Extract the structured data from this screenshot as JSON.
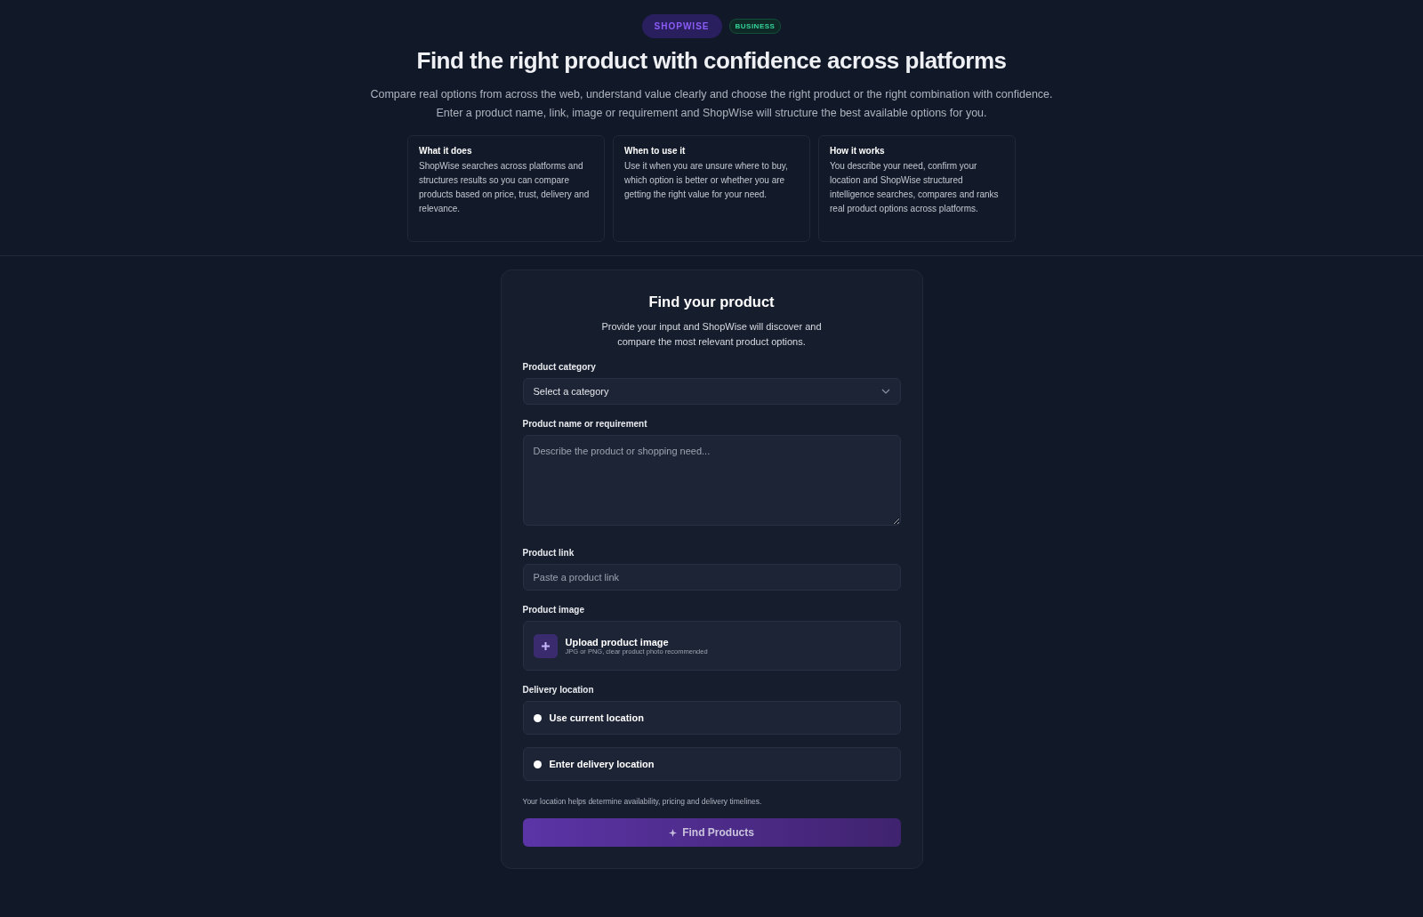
{
  "header": {
    "brand": "SHOPWISE",
    "badge": "BUSINESS",
    "title": "Find the right product with confidence across platforms",
    "subtitle_lines": [
      "Compare real options from across the web, understand value clearly and choose the right product or the right combination with confidence.",
      "Enter a product name, link, image or requirement and ShopWise will structure the best available options for you."
    ]
  },
  "info_cards": [
    {
      "title": "What it does",
      "text": "ShopWise searches across platforms and structures results so you can compare products based on price, trust, delivery and relevance."
    },
    {
      "title": "When to use it",
      "text": "Use it when you are unsure where to buy, which option is better or whether you are getting the right value for your need."
    },
    {
      "title": "How it works",
      "text": "You describe your need, confirm your location and ShopWise structured intelligence searches, compares and ranks real product options across platforms."
    }
  ],
  "form": {
    "title": "Find your product",
    "intro": "Provide your input and ShopWise will discover and compare the most relevant product options.",
    "category": {
      "label": "Product category",
      "value": "Select a category"
    },
    "requirement": {
      "label": "Product name or requirement",
      "placeholder": "Describe the product or shopping need..."
    },
    "link": {
      "label": "Product link",
      "placeholder": "Paste a product link"
    },
    "image": {
      "label": "Product image",
      "title": "Upload product image",
      "hint": "JPG or PNG, clear product photo recommended"
    },
    "delivery": {
      "label": "Delivery location",
      "options": [
        {
          "label": "Use current location",
          "selected": false
        },
        {
          "label": "Enter delivery location",
          "selected": false
        }
      ],
      "note": "Your location helps determine availability, pricing and delivery timelines."
    },
    "submit": "Find Products"
  }
}
